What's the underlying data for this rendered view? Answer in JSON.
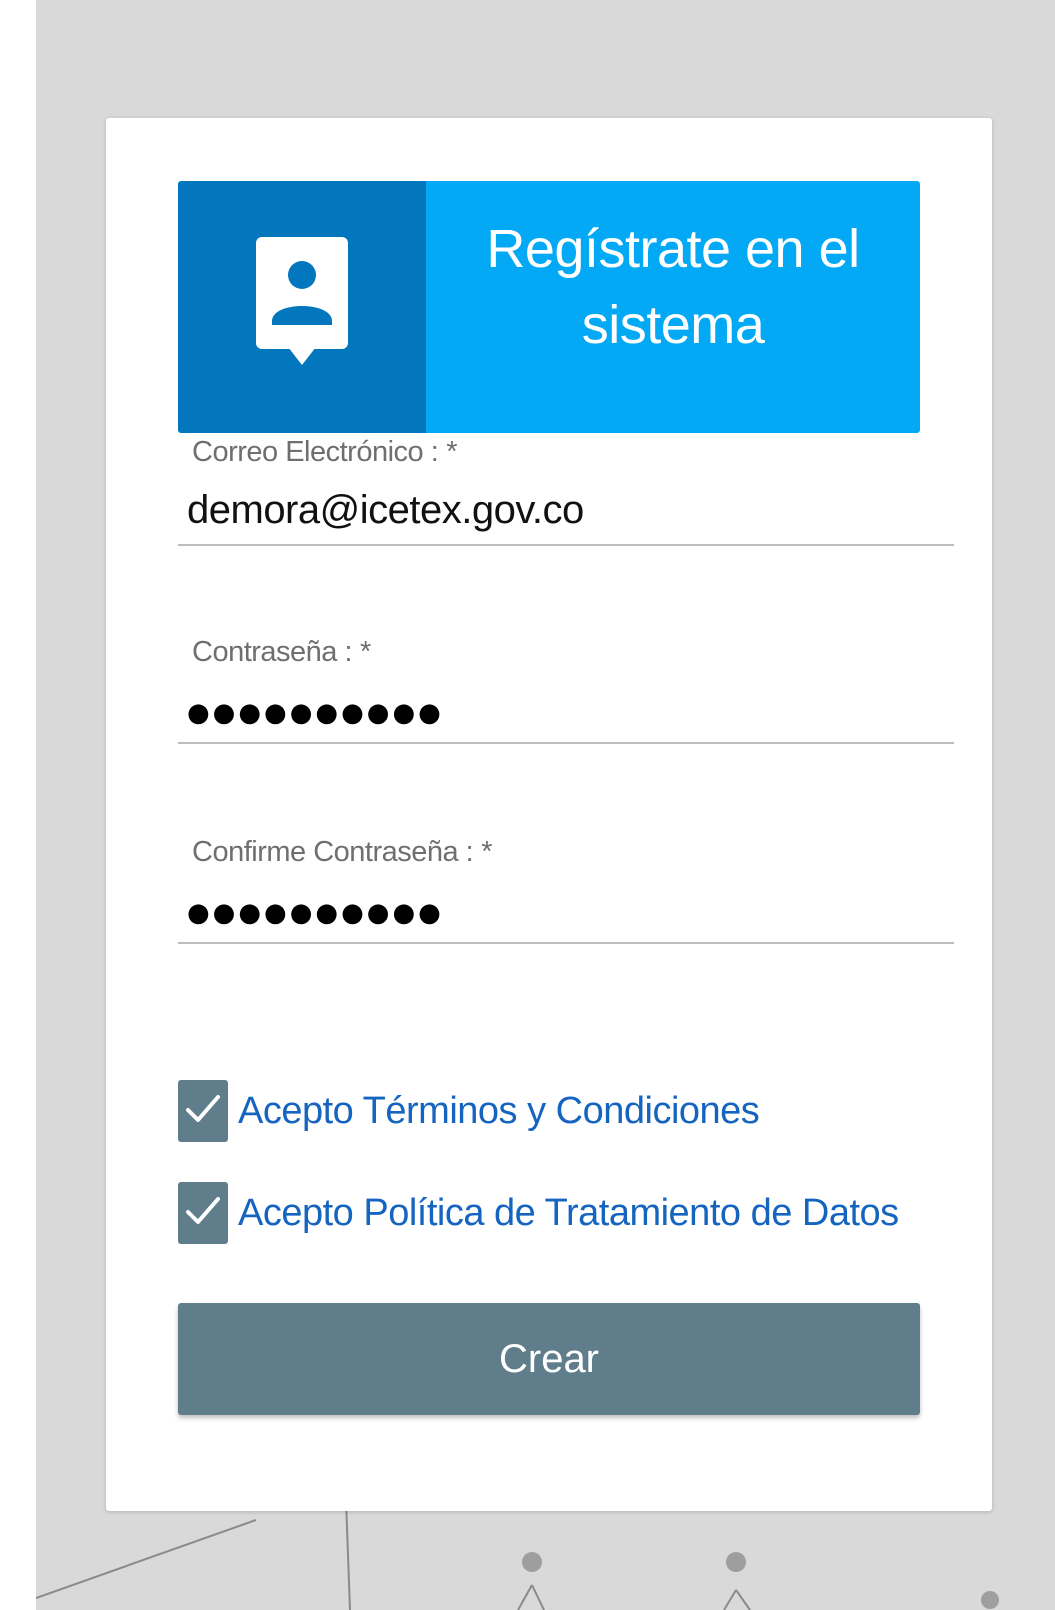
{
  "colors": {
    "background": "#d9d9d9",
    "banner_dark": "#0277bd",
    "banner_light": "#03a9f4",
    "checkbox": "#607d8b",
    "button": "#607d8b",
    "link_text": "#1565c0"
  },
  "banner": {
    "icon": "user-contact-icon",
    "title": "Regístrate en el sistema"
  },
  "form": {
    "email": {
      "label": "Correo Electrónico :",
      "required_mark": "*",
      "value": "demora@icetex.gov.co"
    },
    "password": {
      "label": "Contraseña :",
      "required_mark": "*",
      "value": "●●●●●●●●●●"
    },
    "confirm_password": {
      "label": "Confirme Contraseña :",
      "required_mark": "*",
      "value": "●●●●●●●●●●"
    },
    "terms": {
      "label": "Acepto Términos y Condiciones",
      "checked": true,
      "icon": "checkmark-icon"
    },
    "privacy": {
      "label": "Acepto Política de Tratamiento de Datos",
      "checked": true,
      "icon": "checkmark-icon"
    },
    "submit_label": "Crear"
  }
}
